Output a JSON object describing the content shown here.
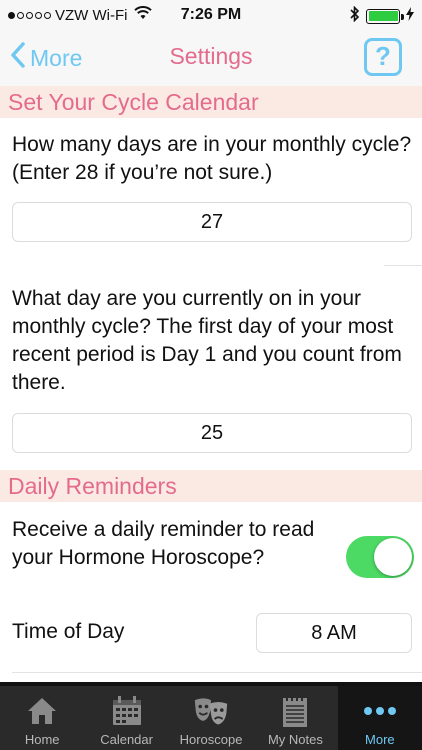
{
  "status_bar": {
    "carrier": "VZW Wi-Fi",
    "time": "7:26 PM"
  },
  "nav": {
    "back_label": "More",
    "title": "Settings",
    "help_label": "?"
  },
  "cycle_section": {
    "header": "Set Your Cycle Calendar",
    "q1": "How many days are in your monthly cycle? (Enter 28 if you’re not sure.)",
    "q1_value": "27",
    "q2": "What day are you currently on in your monthly cycle? The first day of your most recent period is Day 1 and you count from there.",
    "q2_value": "25"
  },
  "reminders_section": {
    "header": "Daily Reminders",
    "reminder_text": "Receive a daily reminder to read your Hormone Horoscope?",
    "reminder_on": true,
    "time_label": "Time of Day",
    "time_value": "8 AM"
  },
  "tabs": [
    {
      "label": "Home",
      "icon": "home-icon"
    },
    {
      "label": "Calendar",
      "icon": "calendar-icon"
    },
    {
      "label": "Horoscope",
      "icon": "masks-icon"
    },
    {
      "label": "My Notes",
      "icon": "notepad-icon"
    },
    {
      "label": "More",
      "icon": "more-dots-icon"
    }
  ],
  "colors": {
    "accent_blue": "#6fc8f2",
    "accent_pink": "#e46b8c",
    "section_bg": "#fbeae4",
    "toggle_on": "#4cd964"
  }
}
